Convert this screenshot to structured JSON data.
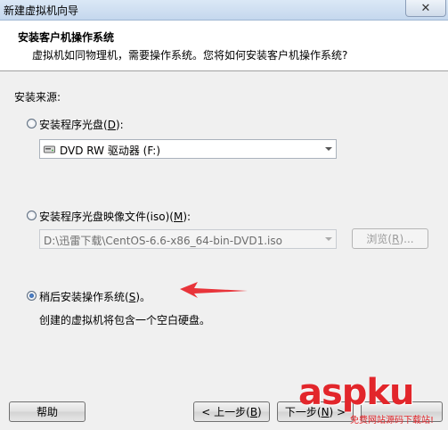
{
  "window": {
    "title": "新建虚拟机向导",
    "close_glyph": "✕"
  },
  "header": {
    "title": "安装客户机操作系统",
    "subtitle": "虚拟机如同物理机，需要操作系统。您将如何安装客户机操作系统?"
  },
  "source": {
    "label": "安装来源:",
    "options": [
      {
        "label": "安装程序光盘(",
        "hotkey": "D",
        "suffix": "):",
        "checked": false,
        "select_value": "DVD RW 驱动器 (F:)",
        "select_icon": "dvd-drive-icon"
      },
      {
        "label": "安装程序光盘映像文件(iso)(",
        "hotkey": "M",
        "suffix": "):",
        "checked": false,
        "select_value": "D:\\迅雷下载\\CentOS-6.6-x86_64-bin-DVD1.iso",
        "browse_label": "浏览(",
        "browse_hotkey": "R",
        "browse_suffix": ")..."
      },
      {
        "label": "稍后安装操作系统(",
        "hotkey": "S",
        "suffix": ")。",
        "checked": true,
        "description": "创建的虚拟机将包含一个空白硬盘。"
      }
    ]
  },
  "annotation": {
    "arrow_color": "#e8343a"
  },
  "buttons": {
    "help": "帮助",
    "back_prefix": "< 上一步(",
    "back_hotkey": "B",
    "back_suffix": ")",
    "next_prefix": "下一步(",
    "next_hotkey": "N",
    "next_suffix": ") >"
  },
  "watermark": {
    "main": "aspku",
    "sub": "免费网站源码下载站!"
  }
}
